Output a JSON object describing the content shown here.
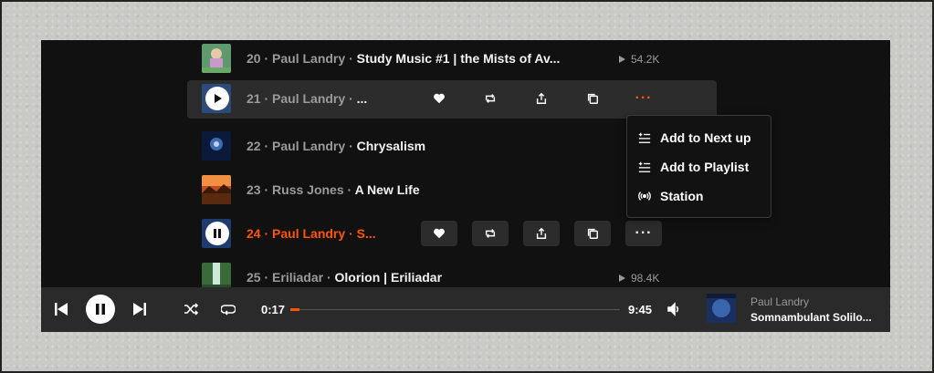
{
  "tracks": [
    {
      "num": "20",
      "artist": "Paul Landry",
      "title": "Study Music #1 | the Mists of Av...",
      "plays": "54.2K",
      "state": "normal"
    },
    {
      "num": "21",
      "artist": "Paul Landry",
      "title": "...",
      "plays": "",
      "state": "hover"
    },
    {
      "num": "22",
      "artist": "Paul Landry",
      "title": "Chrysalism",
      "plays": "",
      "state": "normal"
    },
    {
      "num": "23",
      "artist": "Russ Jones",
      "title": "A New Life",
      "plays": "",
      "state": "normal"
    },
    {
      "num": "24",
      "artist": "Paul Landry",
      "title": "S...",
      "plays": "",
      "state": "current"
    },
    {
      "num": "25",
      "artist": "Eriliadar",
      "title": "Olorion | Eriliadar",
      "plays": "98.4K",
      "state": "normal"
    }
  ],
  "separator": "·",
  "context_menu": {
    "items": [
      {
        "label": "Add to Next up",
        "icon": "add-to-next-up-icon"
      },
      {
        "label": "Add to Playlist",
        "icon": "add-to-playlist-icon"
      },
      {
        "label": "Station",
        "icon": "station-icon"
      }
    ]
  },
  "player": {
    "elapsed": "0:17",
    "duration": "9:45",
    "progress_fraction": 0.029,
    "now_playing_artist": "Paul Landry",
    "now_playing_title": "Somnambulant Solilo..."
  },
  "colors": {
    "accent": "#ff5500",
    "background": "#111111",
    "player_bar": "#2a2a2a"
  }
}
